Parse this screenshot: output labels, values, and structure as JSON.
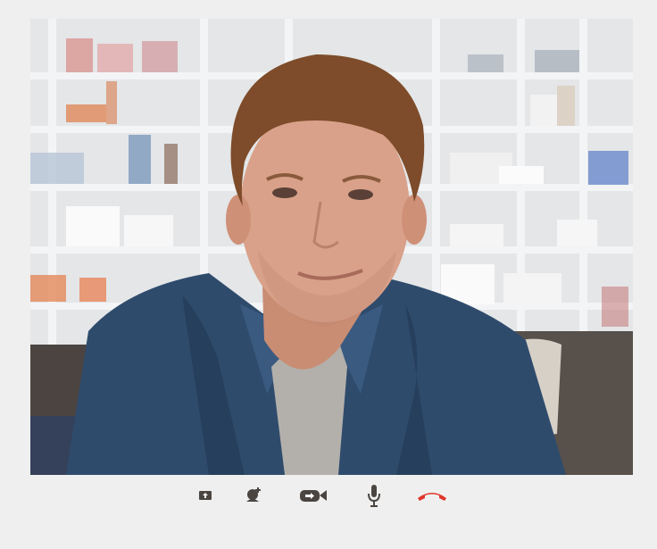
{
  "call": {
    "video": {
      "description_icon": "remote-participant-video-feed"
    },
    "controls": [
      {
        "name": "share-screen-button",
        "icon": "screen-share-icon"
      },
      {
        "name": "add-participant-button",
        "icon": "add-person-icon"
      },
      {
        "name": "toggle-camera-button",
        "icon": "video-camera-icon"
      },
      {
        "name": "toggle-microphone-button",
        "icon": "microphone-icon"
      },
      {
        "name": "end-call-button",
        "icon": "hang-up-phone-icon"
      }
    ]
  },
  "colors": {
    "background": "#efefef",
    "control_icon": "#4a4541",
    "end_call": "#e0362c",
    "shirt": "#2e4a6b",
    "skin": "#d8a088",
    "hair": "#7a4a28"
  }
}
